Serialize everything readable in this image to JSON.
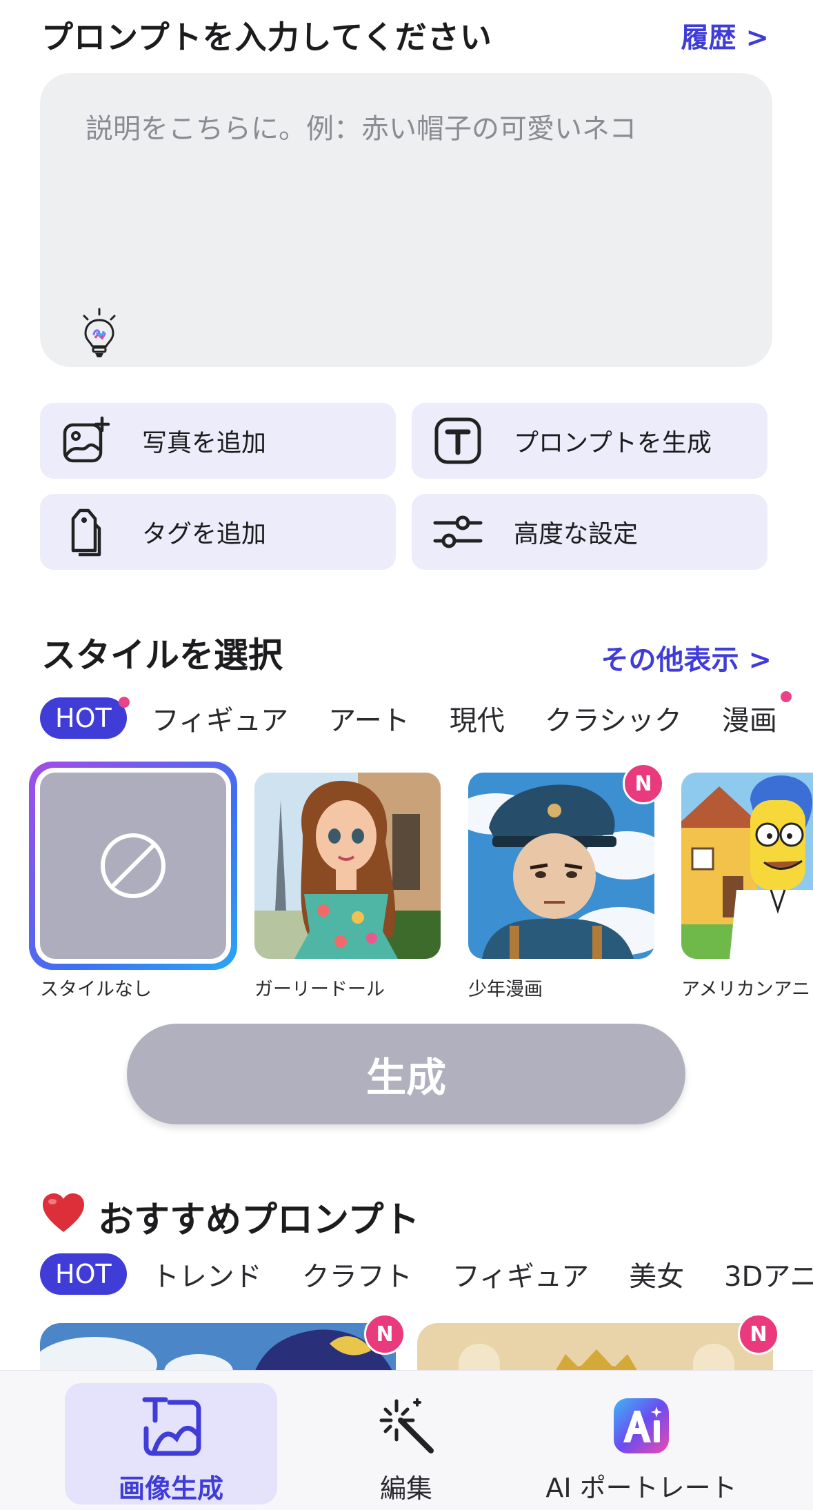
{
  "header": {
    "title": "プロンプトを入力してください",
    "history_link": "履歴 >"
  },
  "prompt": {
    "placeholder": "説明をこちらに。例：赤い帽子の可愛いネコ",
    "hint_icon": "lightbulb-icon"
  },
  "actions": [
    {
      "label": "写真を追加",
      "icon": "add-photo-icon"
    },
    {
      "label": "プロンプトを生成",
      "icon": "text-t-icon"
    },
    {
      "label": "タグを追加",
      "icon": "tag-icon"
    },
    {
      "label": "高度な設定",
      "icon": "sliders-icon"
    }
  ],
  "style_section": {
    "title": "スタイルを選択",
    "more_link": "その他表示 >",
    "tabs": [
      "HOT",
      "フィギュア",
      "アート",
      "現代",
      "クラシック",
      "漫画"
    ],
    "cards": [
      {
        "label": "スタイルなし",
        "selected": true,
        "badge": ""
      },
      {
        "label": "ガーリードール",
        "selected": false,
        "badge": ""
      },
      {
        "label": "少年漫画",
        "selected": false,
        "badge": "N"
      },
      {
        "label": "アメリカンアニ",
        "selected": false,
        "badge": ""
      }
    ]
  },
  "generate_button": "生成",
  "recommended": {
    "title": "おすすめプロンプト",
    "tabs": [
      "HOT",
      "トレンド",
      "クラフト",
      "フィギュア",
      "美女",
      "3Dアニ"
    ],
    "badges": [
      "N",
      "N"
    ]
  },
  "bottom_nav": [
    {
      "label": "画像生成",
      "icon": "image-generate-icon",
      "active": true
    },
    {
      "label": "編集",
      "icon": "magic-wand-icon",
      "active": false
    },
    {
      "label": "AI ポートレート",
      "icon": "ai-app-icon",
      "active": false
    }
  ],
  "colors": {
    "accent": "#3f3cd8",
    "badge": "#e83a7d",
    "button_disabled": "#b1b0be",
    "action_bg": "#ececfb"
  }
}
